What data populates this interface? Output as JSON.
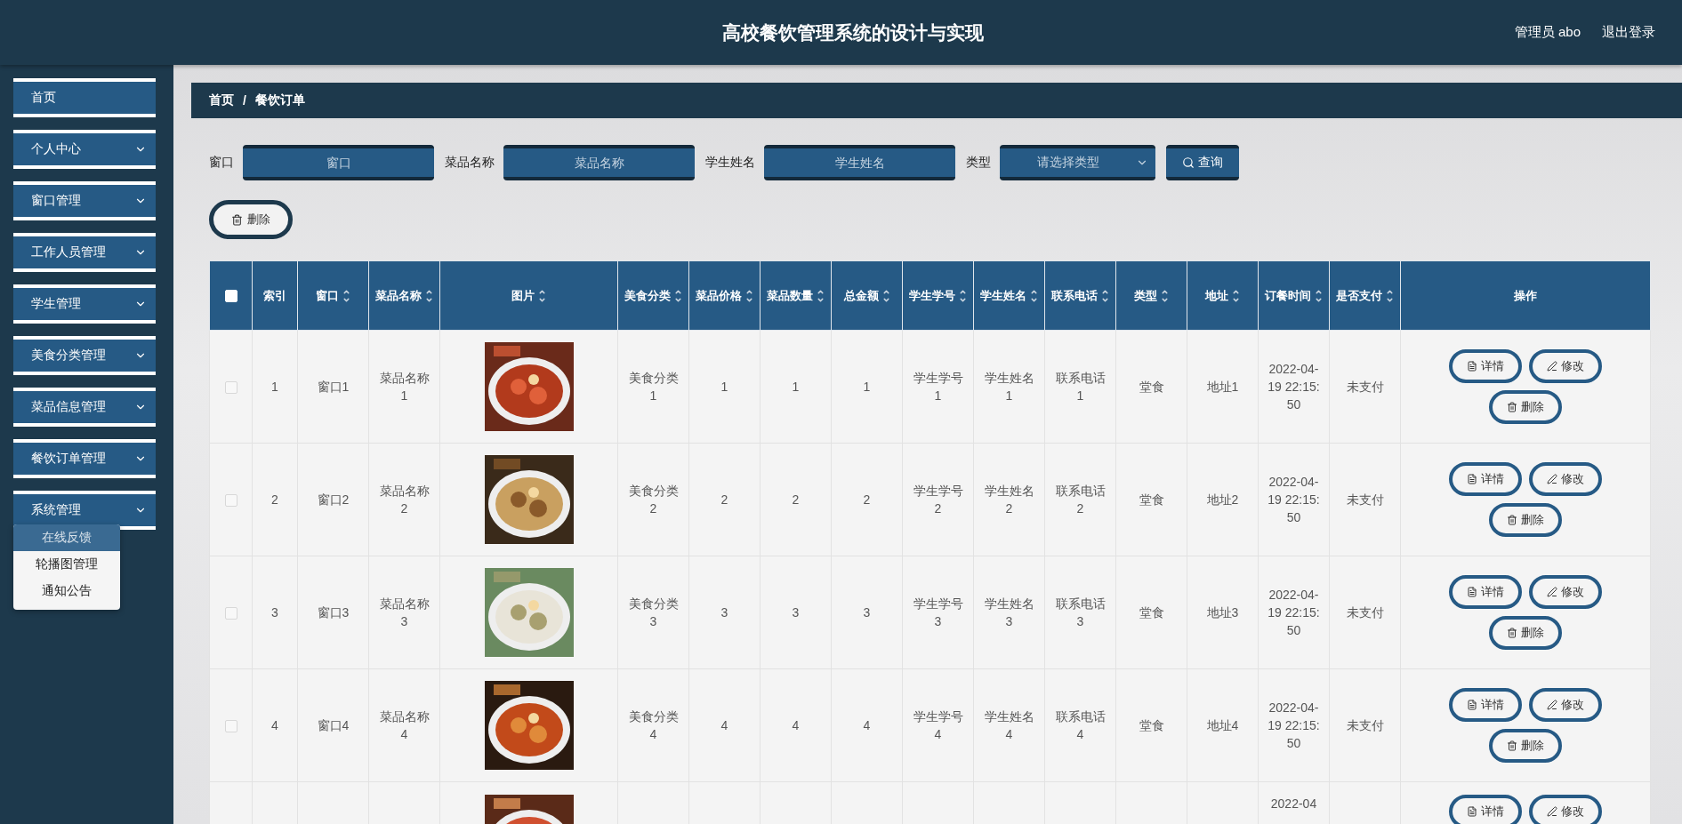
{
  "header": {
    "title": "高校餐饮管理系统的设计与实现",
    "user": "管理员 abo",
    "logout": "退出登录"
  },
  "sidebar": {
    "items": [
      {
        "label": "首页",
        "kind": "link"
      },
      {
        "label": "个人中心",
        "kind": "menu"
      },
      {
        "label": "窗口管理",
        "kind": "menu"
      },
      {
        "label": "工作人员管理",
        "kind": "menu"
      },
      {
        "label": "学生管理",
        "kind": "menu"
      },
      {
        "label": "美食分类管理",
        "kind": "menu"
      },
      {
        "label": "菜品信息管理",
        "kind": "menu"
      },
      {
        "label": "餐饮订单管理",
        "kind": "menu"
      },
      {
        "label": "系统管理",
        "kind": "menu",
        "children": [
          {
            "label": "在线反馈",
            "selected": true
          },
          {
            "label": "轮播图管理",
            "selected": false
          },
          {
            "label": "通知公告",
            "selected": false
          }
        ]
      }
    ]
  },
  "breadcrumb": [
    "首页",
    "餐饮订单"
  ],
  "breadcrumb_separator": "/",
  "filters": [
    {
      "label": "窗口",
      "kind": "input",
      "placeholder": "窗口"
    },
    {
      "label": "菜品名称",
      "kind": "input",
      "placeholder": "菜品名称"
    },
    {
      "label": "学生姓名",
      "kind": "input",
      "placeholder": "学生姓名"
    },
    {
      "label": "类型",
      "kind": "select",
      "placeholder": "请选择类型"
    }
  ],
  "search_button": "查询",
  "delete_button": "删除",
  "table": {
    "select_all": {
      "checked": false
    },
    "columns": [
      {
        "label": "索引",
        "sortable": false
      },
      {
        "label": "窗口",
        "sortable": true
      },
      {
        "label": "菜品名称",
        "sortable": true
      },
      {
        "label": "图片",
        "sortable": true
      },
      {
        "label": "美食分类",
        "sortable": true
      },
      {
        "label": "菜品价格",
        "sortable": true
      },
      {
        "label": "菜品数量",
        "sortable": true
      },
      {
        "label": "总金额",
        "sortable": true
      },
      {
        "label": "学生学号",
        "sortable": true
      },
      {
        "label": "学生姓名",
        "sortable": true
      },
      {
        "label": "联系电话",
        "sortable": true
      },
      {
        "label": "类型",
        "sortable": true
      },
      {
        "label": "地址",
        "sortable": true
      },
      {
        "label": "订餐时间",
        "sortable": true
      },
      {
        "label": "是否支付",
        "sortable": true
      },
      {
        "label": "操作",
        "sortable": false
      }
    ],
    "rows": [
      {
        "checked": false,
        "cells": [
          "1",
          "窗口1",
          "菜品名称1",
          {
            "kind": "picture"
          },
          "美食分类1",
          "1",
          "1",
          "1",
          "学生学号1",
          "学生姓名1",
          "联系电话1",
          "堂食",
          "地址1",
          "2022-04-19 22:15:50",
          "未支付"
        ],
        "actions": [
          {
            "kind": "detail",
            "label": "详情"
          },
          {
            "kind": "edit",
            "label": "修改"
          },
          {
            "kind": "delete",
            "label": "删除"
          }
        ]
      },
      {
        "checked": false,
        "cells": [
          "2",
          "窗口2",
          "菜品名称2",
          {
            "kind": "picture"
          },
          "美食分类2",
          "2",
          "2",
          "2",
          "学生学号2",
          "学生姓名2",
          "联系电话2",
          "堂食",
          "地址2",
          "2022-04-19 22:15:50",
          "未支付"
        ],
        "actions": [
          {
            "kind": "detail",
            "label": "详情"
          },
          {
            "kind": "edit",
            "label": "修改"
          },
          {
            "kind": "delete",
            "label": "删除"
          }
        ]
      },
      {
        "checked": false,
        "cells": [
          "3",
          "窗口3",
          "菜品名称3",
          {
            "kind": "picture"
          },
          "美食分类3",
          "3",
          "3",
          "3",
          "学生学号3",
          "学生姓名3",
          "联系电话3",
          "堂食",
          "地址3",
          "2022-04-19 22:15:50",
          "未支付"
        ],
        "actions": [
          {
            "kind": "detail",
            "label": "详情"
          },
          {
            "kind": "edit",
            "label": "修改"
          },
          {
            "kind": "delete",
            "label": "删除"
          }
        ]
      },
      {
        "checked": false,
        "cells": [
          "4",
          "窗口4",
          "菜品名称4",
          {
            "kind": "picture"
          },
          "美食分类4",
          "4",
          "4",
          "4",
          "学生学号4",
          "学生姓名4",
          "联系电话4",
          "堂食",
          "地址4",
          "2022-04-19 22:15:50",
          "未支付"
        ],
        "actions": [
          {
            "kind": "detail",
            "label": "详情"
          },
          {
            "kind": "edit",
            "label": "修改"
          },
          {
            "kind": "delete",
            "label": "删除"
          }
        ]
      },
      {
        "cells": [
          "",
          "",
          "",
          {
            "kind": "picture"
          },
          "",
          "",
          "",
          "",
          "",
          "",
          "",
          "",
          "",
          "2022-04",
          ""
        ],
        "actions": [
          {
            "kind": "detail",
            "label": "详情"
          },
          {
            "kind": "edit",
            "label": "修改"
          }
        ]
      }
    ]
  }
}
